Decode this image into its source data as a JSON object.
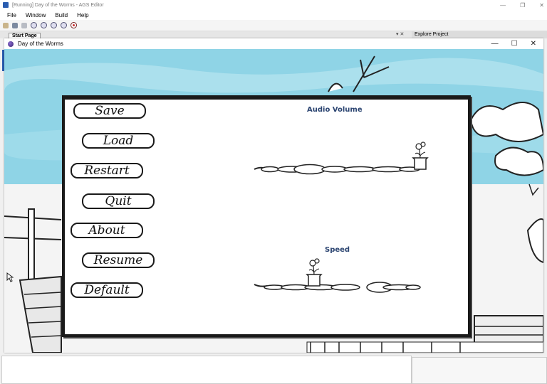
{
  "editor": {
    "title": "[Running] Day of the Worms - AGS Editor",
    "controls": [
      "—",
      "❐",
      "✕"
    ]
  },
  "menu": [
    "File",
    "Window",
    "Build",
    "Help"
  ],
  "tabs": {
    "start_page": "Start Page",
    "explore": "Explore Project",
    "close": "▾ ✕"
  },
  "game_window": {
    "title": "Day of the Worms",
    "controls": [
      "—",
      "☐",
      "✕"
    ]
  },
  "panel": {
    "buttons": [
      "Save",
      "Load",
      "Restart",
      "Quit",
      "About",
      "Resume",
      "Default"
    ],
    "audio_heading": "Audio Volume",
    "speed_heading": "Speed",
    "audio_volume_level": 1.0,
    "speed_level": 0.33
  },
  "colors": {
    "sky": "#8fd4e6",
    "heading": "#2d4672",
    "ink": "#1a1a1a"
  }
}
